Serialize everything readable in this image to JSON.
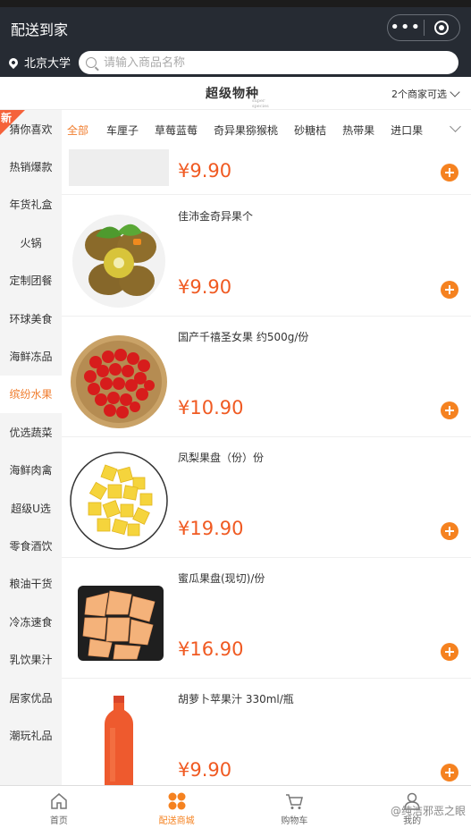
{
  "header": {
    "title": "配送到家",
    "more_icon": "more-dots-icon",
    "close_icon": "target-close-icon"
  },
  "location": {
    "name": "北京大学"
  },
  "search": {
    "placeholder": "请输入商品名称"
  },
  "store": {
    "logo_text": "超级物种",
    "logo_sub": "super species",
    "selector_label": "2个商家可选"
  },
  "sidebar": {
    "new_badge": "新",
    "items": [
      {
        "label": "猜你喜欢"
      },
      {
        "label": "热销爆款"
      },
      {
        "label": "年货礼盒"
      },
      {
        "label": "火锅"
      },
      {
        "label": "定制团餐"
      },
      {
        "label": "环球美食"
      },
      {
        "label": "海鲜冻品"
      },
      {
        "label": "缤纷水果"
      },
      {
        "label": "优选蔬菜"
      },
      {
        "label": "海鲜肉禽"
      },
      {
        "label": "超级U选"
      },
      {
        "label": "零食酒饮"
      },
      {
        "label": "粮油干货"
      },
      {
        "label": "冷冻速食"
      },
      {
        "label": "乳饮果汁"
      },
      {
        "label": "居家优品"
      },
      {
        "label": "潮玩礼品"
      }
    ],
    "active_index": 7
  },
  "tabs": [
    {
      "label": "全部"
    },
    {
      "label": "车厘子"
    },
    {
      "label": "草莓蓝莓"
    },
    {
      "label": "奇异果猕猴桃"
    },
    {
      "label": "砂糖桔"
    },
    {
      "label": "热带果"
    },
    {
      "label": "进口果"
    }
  ],
  "products": [
    {
      "name": "",
      "price": "¥9.90"
    },
    {
      "name": "佳沛金奇异果个",
      "price": "¥9.90"
    },
    {
      "name": "国产千禧圣女果 约500g/份",
      "price": "¥10.90"
    },
    {
      "name": "凤梨果盘（份）份",
      "price": "¥19.90"
    },
    {
      "name": "蜜瓜果盘(现切)/份",
      "price": "¥16.90"
    },
    {
      "name": "胡萝卜苹果汁 330ml/瓶",
      "price": "¥9.90"
    }
  ],
  "tabbar": [
    {
      "label": "首页",
      "icon": "home-icon"
    },
    {
      "label": "配送商城",
      "icon": "grid-shop-icon"
    },
    {
      "label": "购物车",
      "icon": "cart-icon"
    },
    {
      "label": "我的",
      "icon": "user-icon"
    }
  ],
  "watermark": "@纯洁邪恶之眼",
  "colors": {
    "accent": "#f58220",
    "price": "#f05a22",
    "header_bg": "#262b33"
  }
}
